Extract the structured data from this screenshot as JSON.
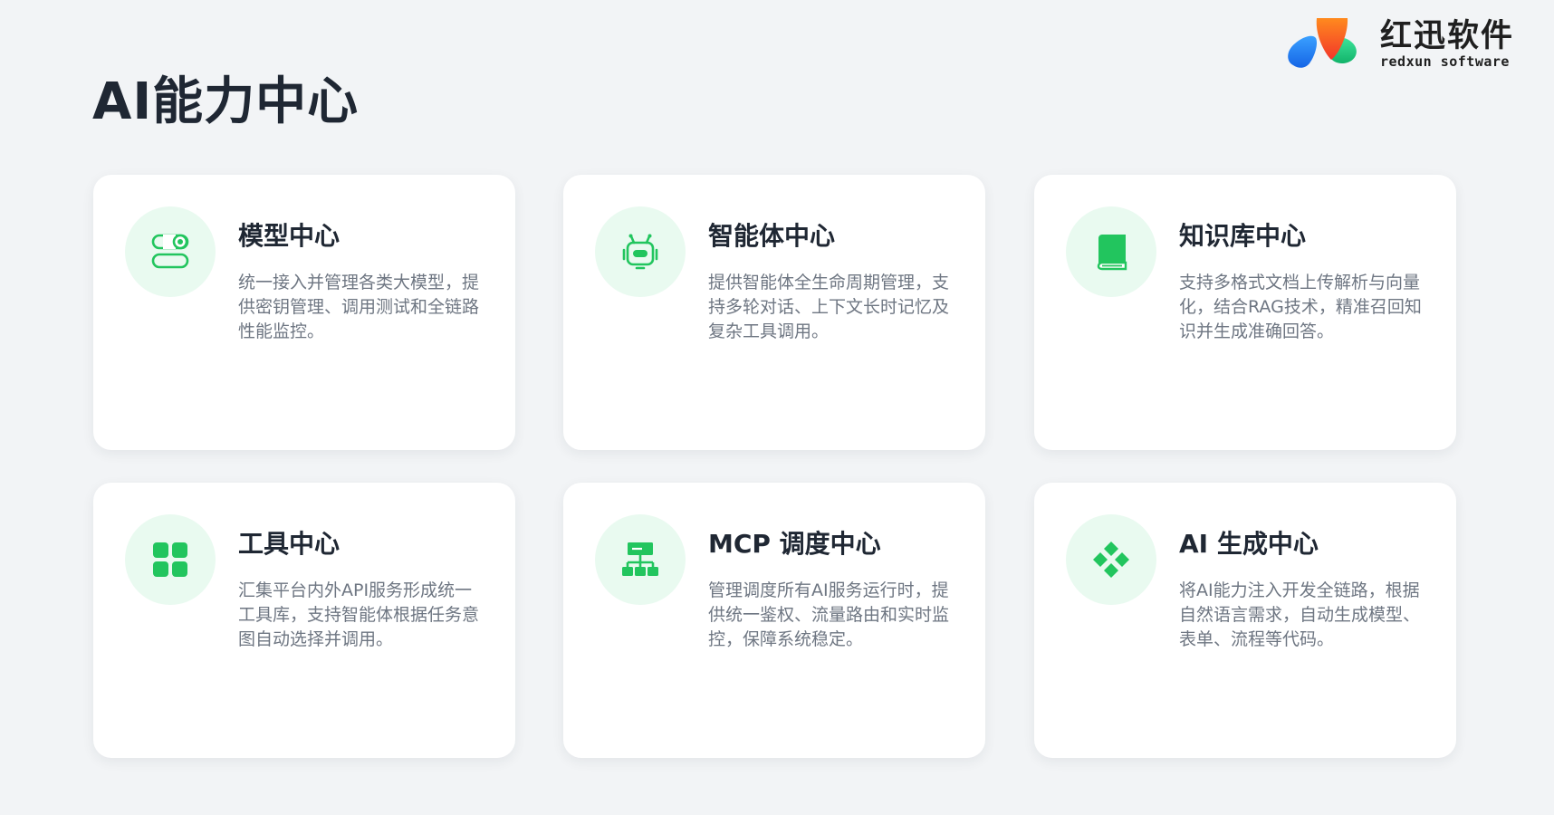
{
  "brand": {
    "name_cn": "红迅软件",
    "name_en": "redxun software",
    "colors": [
      "#1d7cf2",
      "#fb5a1f",
      "#1fce82"
    ]
  },
  "page": {
    "title": "AI能力中心"
  },
  "theme": {
    "accent": "#22c55e",
    "icon_bg": "#e9faf0"
  },
  "cards": [
    {
      "icon": "model-toggle-icon",
      "title": "模型中心",
      "desc": "统一接入并管理各类大模型，提供密钥管理、调用测试和全链路性能监控。"
    },
    {
      "icon": "robot-icon",
      "title": "智能体中心",
      "desc": "提供智能体全生命周期管理，支持多轮对话、上下文长时记忆及复杂工具调用。"
    },
    {
      "icon": "book-icon",
      "title": "知识库中心",
      "desc": "支持多格式文档上传解析与向量化，结合RAG技术，精准召回知识并生成准确回答。"
    },
    {
      "icon": "grid-apps-icon",
      "title": "工具中心",
      "desc": "汇集平台内外API服务形成统一工具库，支持智能体根据任务意图自动选择并调用。"
    },
    {
      "icon": "hierarchy-icon",
      "title": "MCP 调度中心",
      "desc": "管理调度所有AI服务运行时，提供统一鉴权、流量路由和实时监控，保障系统稳定。"
    },
    {
      "icon": "diamonds-icon",
      "title": "AI 生成中心",
      "desc": "将AI能力注入开发全链路，根据自然语言需求，自动生成模型、表单、流程等代码。"
    }
  ]
}
